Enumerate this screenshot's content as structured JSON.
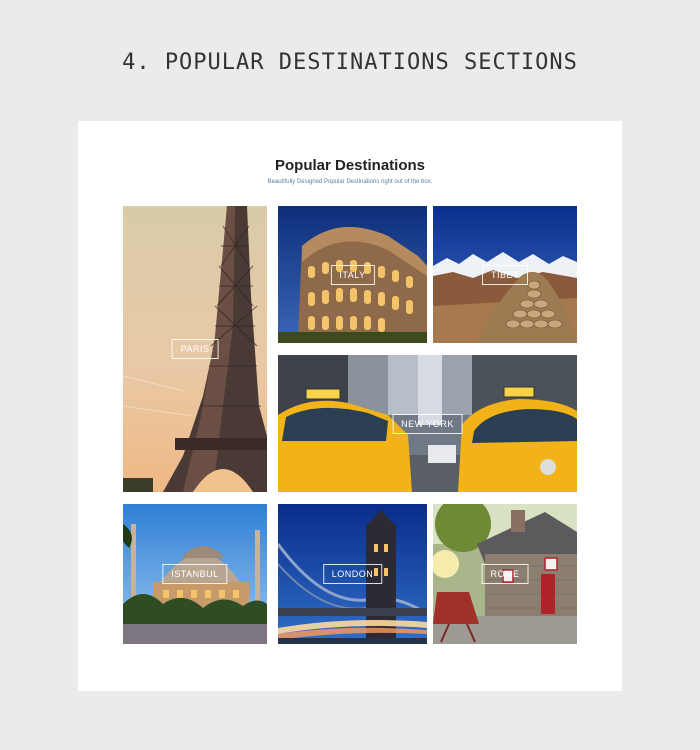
{
  "banner": {
    "title": "4. POPULAR DESTINATIONS SECTIONS"
  },
  "section": {
    "title": "Popular Destinations",
    "subtitle": "Beautifully Designed Popular Destinations right out of the box."
  },
  "destinations": [
    {
      "id": "paris",
      "label": "PARIS"
    },
    {
      "id": "italy",
      "label": "ITALY"
    },
    {
      "id": "tibet",
      "label": "TIBET"
    },
    {
      "id": "new-york",
      "label": "NEW YORK"
    },
    {
      "id": "istanbul",
      "label": "ISTANBUL"
    },
    {
      "id": "london",
      "label": "LONDON"
    },
    {
      "id": "rome",
      "label": "ROME"
    }
  ]
}
